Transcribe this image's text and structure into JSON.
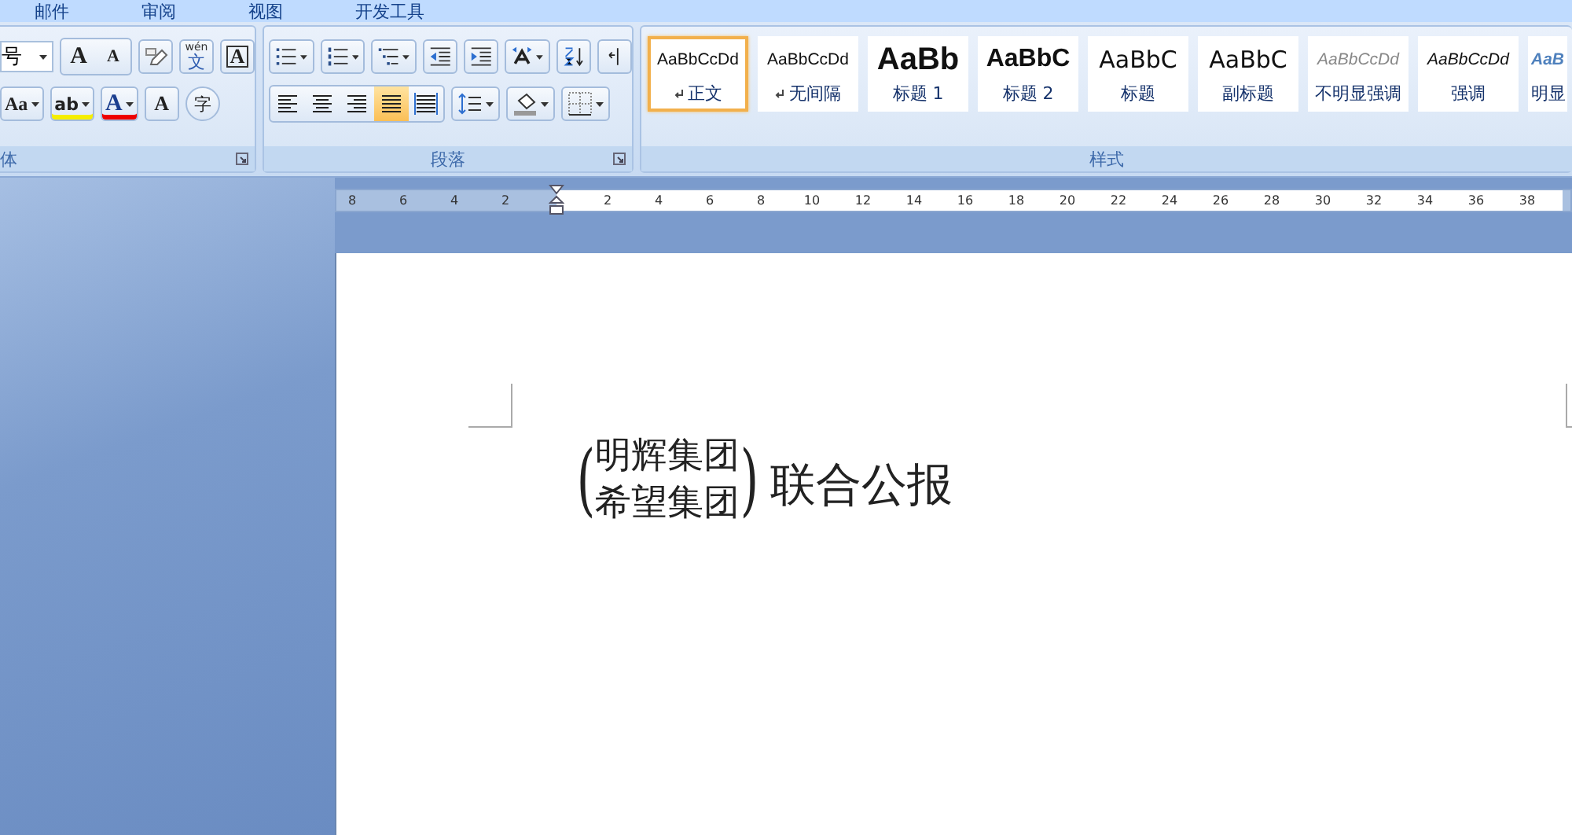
{
  "tabs": [
    {
      "label": "邮件"
    },
    {
      "label": "审阅"
    },
    {
      "label": "视图"
    },
    {
      "label": "开发工具"
    }
  ],
  "font_group": {
    "label": "体",
    "size_field": {
      "value": "号"
    },
    "row1": [
      {
        "kind": "grow",
        "glyph": "A"
      },
      {
        "kind": "shrink",
        "glyph": "A"
      },
      {
        "kind": "clear"
      },
      {
        "kind": "phonetic",
        "glyph": "文",
        "sup": "wén"
      },
      {
        "kind": "border",
        "glyph": "A"
      }
    ],
    "row2": [
      {
        "kind": "case",
        "glyph": "Aa"
      },
      {
        "kind": "highlight",
        "glyph": "ab"
      },
      {
        "kind": "color",
        "glyph": "A"
      },
      {
        "kind": "shading",
        "glyph": "A"
      },
      {
        "kind": "enclose",
        "glyph": "字"
      }
    ]
  },
  "paragraph_group": {
    "label": "段落",
    "row1": [
      {
        "kind": "bullets"
      },
      {
        "kind": "numbering"
      },
      {
        "kind": "multilevel"
      },
      {
        "kind": "outdent"
      },
      {
        "kind": "indent"
      },
      {
        "kind": "asian-layout"
      },
      {
        "kind": "sort"
      },
      {
        "kind": "marks"
      }
    ],
    "alignment": [
      {
        "kind": "left",
        "selected": false
      },
      {
        "kind": "center",
        "selected": false
      },
      {
        "kind": "right",
        "selected": false
      },
      {
        "kind": "justify",
        "selected": true
      },
      {
        "kind": "distributed",
        "selected": false
      }
    ],
    "row2": [
      {
        "kind": "line-spacing"
      },
      {
        "kind": "shading"
      },
      {
        "kind": "borders"
      }
    ]
  },
  "styles_group": {
    "label": "样式",
    "items": [
      {
        "sample": "AaBbCcDd",
        "label": "正文",
        "kind": "normal",
        "mark": true,
        "selected": true
      },
      {
        "sample": "AaBbCcDd",
        "label": "无间隔",
        "kind": "normal",
        "mark": true,
        "selected": false
      },
      {
        "sample": "AaBb",
        "label": "标题 1",
        "kind": "heading1",
        "mark": false,
        "selected": false
      },
      {
        "sample": "AaBbC",
        "label": "标题 2",
        "kind": "heading2",
        "mark": false,
        "selected": false
      },
      {
        "sample": "AaBbC",
        "label": "标题",
        "kind": "title",
        "mark": false,
        "selected": false
      },
      {
        "sample": "AaBbC",
        "label": "副标题",
        "kind": "subtitle",
        "mark": false,
        "selected": false
      },
      {
        "sample": "AaBbCcDd",
        "label": "不明显强调",
        "kind": "subtle",
        "mark": false,
        "selected": false
      },
      {
        "sample": "AaBbCcDd",
        "label": "强调",
        "kind": "emphasis",
        "mark": false,
        "selected": false
      },
      {
        "sample": "AaB",
        "label": "明显",
        "kind": "intense",
        "mark": false,
        "selected": false
      }
    ]
  },
  "ruler": {
    "left_numbers": [
      "8",
      "6",
      "4",
      "2"
    ],
    "right_numbers": [
      "2",
      "4",
      "6",
      "8",
      "10",
      "12",
      "14",
      "16",
      "18",
      "20",
      "22",
      "24",
      "26",
      "28",
      "30",
      "32",
      "34",
      "36",
      "38"
    ]
  },
  "document": {
    "open_bracket": "(",
    "combined_lines": [
      "明辉集团",
      "希望集团"
    ],
    "close_bracket": ")",
    "text": "联合公报"
  }
}
